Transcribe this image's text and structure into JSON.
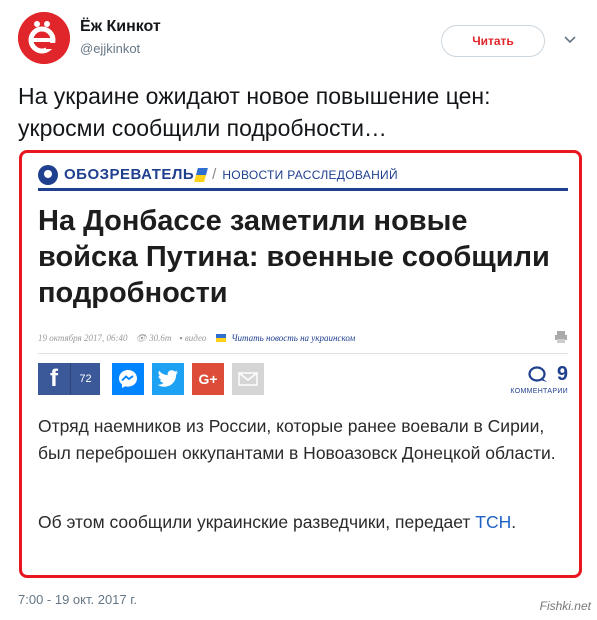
{
  "user": {
    "name": "Ёж Кинкот",
    "handle": "@ejjkinkot",
    "avatar_letter": "ё"
  },
  "follow_button": {
    "label": "Читать"
  },
  "tweet": {
    "text": "На украине ожидают новое повышение цен: укросми сообщили подробности…",
    "timestamp": "7:00 - 19 окт. 2017 г."
  },
  "card": {
    "site_name": "ОБОЗРЕВАТЕЛЬ",
    "separator": "/",
    "section": "НОВОСТИ РАССЛЕДОВАНИЙ",
    "headline": "На Донбассе заметили новые войска Путина: военные сообщили подробности",
    "meta": {
      "date": "19 октября 2017, 06:40",
      "views": "30.6т",
      "video": "видео",
      "ua_link": "Читать новость на украинском"
    },
    "share": {
      "facebook_glyph": "f",
      "facebook_count": "72",
      "googleplus_label": "G+",
      "comments_count": "9",
      "comments_label": "КОММЕНТАРИИ"
    },
    "paragraph1": "Отряд наемников из России, которые ранее воевали в Сирии, был переброшен оккупантами в Новоазовск Донецкой области.",
    "paragraph2_text": "Об этом сообщили украинские разведчики, передает ",
    "paragraph2_link": "ТСН",
    "paragraph2_end": "."
  },
  "watermark": "Fishki.net",
  "colors": {
    "accent_red": "#e8171f",
    "site_blue": "#1f3f8f",
    "facebook": "#3b5998",
    "messenger": "#0084ff",
    "twitter": "#1da1f2",
    "googleplus": "#dd4b39"
  }
}
